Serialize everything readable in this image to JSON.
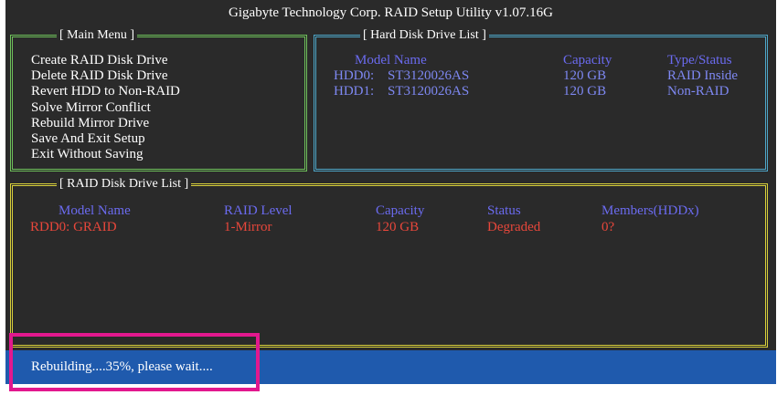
{
  "title": "Gigabyte Technology Corp.  RAID Setup Utility v1.07.16G",
  "main_menu": {
    "label": "[ Main Menu ]",
    "items": [
      "Create RAID Disk Drive",
      "Delete RAID Disk Drive",
      "Revert HDD to Non-RAID",
      "Solve Mirror Conflict",
      "Rebuild Mirror Drive",
      "Save And Exit Setup",
      "Exit Without Saving"
    ]
  },
  "hdd_list": {
    "label": "[ Hard Disk Drive List ]",
    "headers": {
      "model": "Model Name",
      "capacity": "Capacity",
      "type": "Type/Status"
    },
    "rows": [
      {
        "id": "HDD0:",
        "model": "ST3120026AS",
        "capacity": "120 GB",
        "type": "RAID Inside"
      },
      {
        "id": "HDD1:",
        "model": "ST3120026AS",
        "capacity": "120 GB",
        "type": "Non-RAID"
      }
    ]
  },
  "raid_list": {
    "label": "[ RAID Disk Drive List ]",
    "headers": {
      "model": "Model Name",
      "level": "RAID Level",
      "capacity": "Capacity",
      "status": "Status",
      "members": "Members(HDDx)"
    },
    "rows": [
      {
        "model": "RDD0: GRAID",
        "level": "1-Mirror",
        "capacity": "120 GB",
        "status": "Degraded",
        "members": "0?"
      }
    ]
  },
  "status": {
    "text": "Rebuilding....35%, please wait....",
    "progress_percent": 35
  },
  "colors": {
    "background": "#2a2a2a",
    "main_frame": "#6ec05a",
    "hdd_frame": "#4da6c8",
    "raid_frame": "#d8cf3a",
    "header_text": "#6b6bf0",
    "hdd_text": "#7e88f2",
    "raid_text": "#e8473b",
    "status_bar": "#1f5aad",
    "highlight": "#e2188e"
  }
}
